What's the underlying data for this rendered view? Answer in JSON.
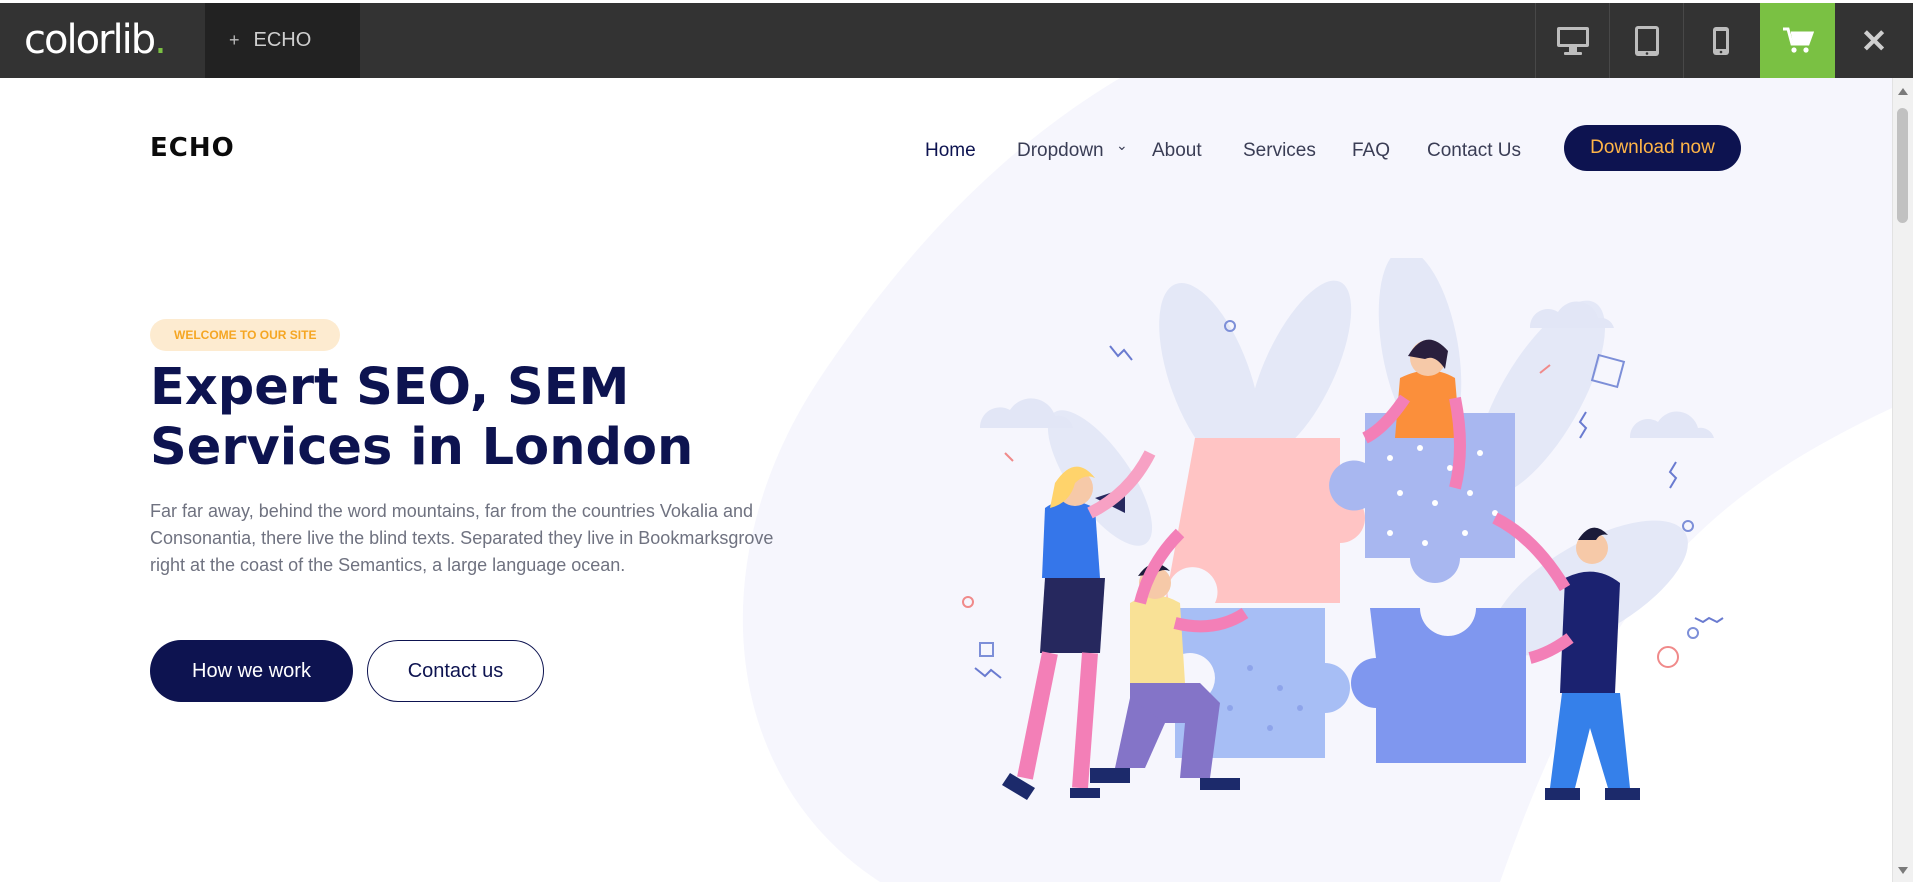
{
  "topbar": {
    "brand_name": "colorlib",
    "brand_dot": ".",
    "tab_plus": "+",
    "tab_label": "ECHO",
    "devices": [
      "desktop-icon",
      "tablet-icon",
      "mobile-icon"
    ],
    "cart_icon": "cart-icon",
    "close_icon": "close-icon",
    "close_glyph": "✕",
    "accent_color": "#7ac143"
  },
  "site": {
    "logo": "ECHO",
    "nav": {
      "items": [
        {
          "label": "Home",
          "active": true
        },
        {
          "label": "Dropdown",
          "has_dropdown": true
        },
        {
          "label": "About"
        },
        {
          "label": "Services"
        },
        {
          "label": "FAQ"
        },
        {
          "label": "Contact Us"
        }
      ],
      "dropdown_glyph": "⌄",
      "cta_label": "Download now"
    },
    "hero": {
      "badge": "WELCOME TO OUR SITE",
      "title": "Expert SEO, SEM Services in London",
      "text": "Far far away, behind the word mountains, far from the countries Vokalia and Consonantia, there live the blind texts. Separated they live in Bookmarksgrove right at the coast of the Semantics, a large language ocean.",
      "primary_button": "How we work",
      "secondary_button": "Contact us"
    },
    "colors": {
      "primary": "#0d1350",
      "accent": "#ffb547",
      "badge_bg": "#fdebd0"
    }
  }
}
